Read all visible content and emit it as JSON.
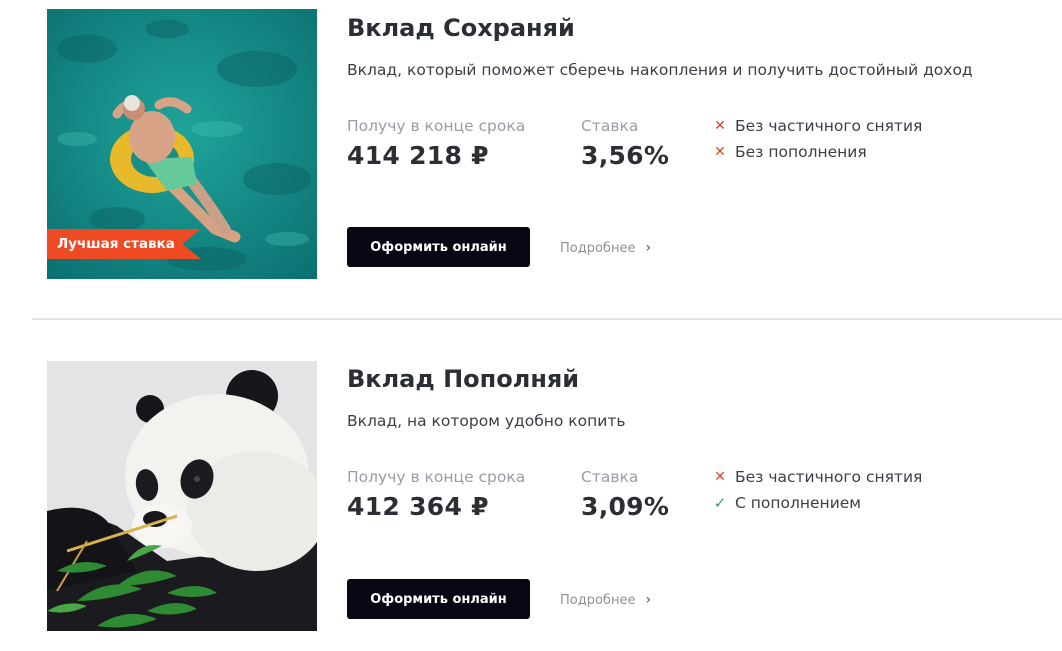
{
  "deposits": [
    {
      "title": "Вклад Сохраняй",
      "subtitle": "Вклад, который поможет сберечь накопления и получить достойный доход",
      "badge": "Лучшая ставка",
      "payout_label": "Получу в конце срока",
      "payout_value": "414 218 ₽",
      "rate_label": "Ставка",
      "rate_value": "3,56%",
      "features": [
        {
          "text": "Без частичного снятия",
          "icon": "cross-icon"
        },
        {
          "text": "Без пополнения",
          "icon": "cross-icon"
        }
      ],
      "button_label": "Оформить онлайн",
      "more_label": "Подробнее"
    },
    {
      "title": "Вклад Пополняй",
      "subtitle": "Вклад, на котором удобно копить",
      "payout_label": "Получу в конце срока",
      "payout_value": "412 364 ₽",
      "rate_label": "Ставка",
      "rate_value": "3,09%",
      "features": [
        {
          "text": "Без частичного снятия",
          "icon": "cross-icon"
        },
        {
          "text": "С пополнением",
          "icon": "check-icon"
        }
      ],
      "button_label": "Оформить онлайн",
      "more_label": "Подробнее"
    }
  ],
  "colors": {
    "accent": "#ee4a24",
    "button": "#070714",
    "cross": "#e0452e",
    "check": "#2ea65a"
  }
}
